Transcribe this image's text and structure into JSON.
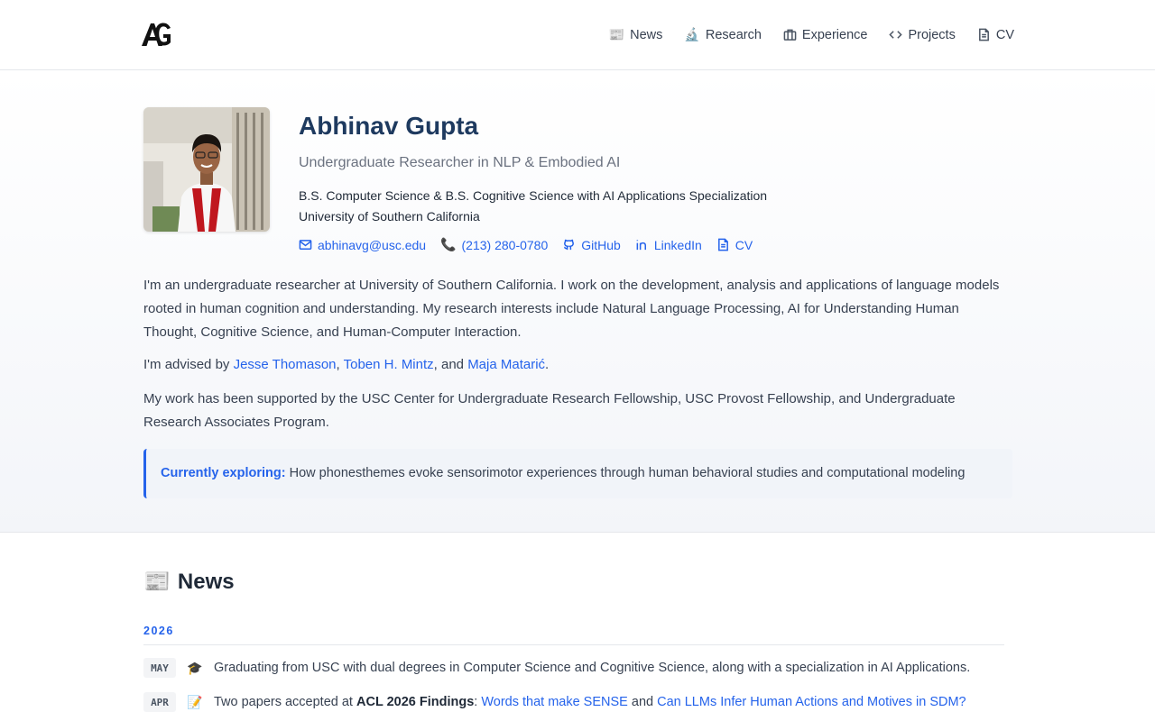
{
  "nav": {
    "items": [
      {
        "icon": "newspaper-emoji",
        "emoji": "📰",
        "label": "News"
      },
      {
        "icon": "microscope-emoji",
        "emoji": "🔬",
        "label": "Research"
      },
      {
        "icon": "briefcase-icon",
        "label": "Experience"
      },
      {
        "icon": "code-icon",
        "label": "Projects"
      },
      {
        "icon": "document-icon",
        "label": "CV"
      }
    ]
  },
  "profile": {
    "name": "Abhinav Gupta",
    "subtitle": "Undergraduate Researcher in NLP & Embodied AI",
    "degree": "B.S. Computer Science & B.S. Cognitive Science with AI Applications Specialization",
    "university": "University of Southern California",
    "contacts": {
      "email": "abhinavg@usc.edu",
      "phone": "(213) 280-0780",
      "github": "GitHub",
      "linkedin": "LinkedIn",
      "cv": "CV"
    }
  },
  "bio": {
    "intro": "I'm an undergraduate researcher at University of Southern California. I work on the development, analysis and applications of language models rooted in human cognition and understanding. My research interests include Natural Language Processing, AI for Understanding Human Thought, Cognitive Science, and Human-Computer Interaction.",
    "advised_prefix": "I'm advised by ",
    "advisor_1": "Jesse Thomason",
    "sep_1": ", ",
    "advisor_2": "Toben H. Mintz",
    "sep_2": ", and ",
    "advisor_3": "Maja Matarić",
    "advised_suffix": ".",
    "support": "My work has been supported by the USC Center for Undergraduate Research Fellowship, USC Provost Fellowship, and Undergraduate Research Associates Program.",
    "callout_label": "Currently exploring:",
    "callout_text": " How phonesthemes evoke sensorimotor experiences through human behavioral studies and computational modeling"
  },
  "news": {
    "title_emoji": "📰",
    "title": "News",
    "year": "2026",
    "items": [
      {
        "month": "MAY",
        "emoji": "🎓",
        "text": "Graduating from USC with dual degrees in Computer Science and Cognitive Science, along with a specialization in AI Applications."
      },
      {
        "month": "APR",
        "emoji": "📝",
        "prefix": "Two papers accepted at ",
        "venue": "ACL 2026 Findings",
        "colon": ": ",
        "link_1": "Words that make SENSE",
        "and": " and ",
        "link_2": "Can LLMs Infer Human Actions and Motives in SDM?"
      }
    ]
  },
  "colors": {
    "accent": "#2563eb",
    "name": "#1e3a5f",
    "text": "#374151"
  }
}
